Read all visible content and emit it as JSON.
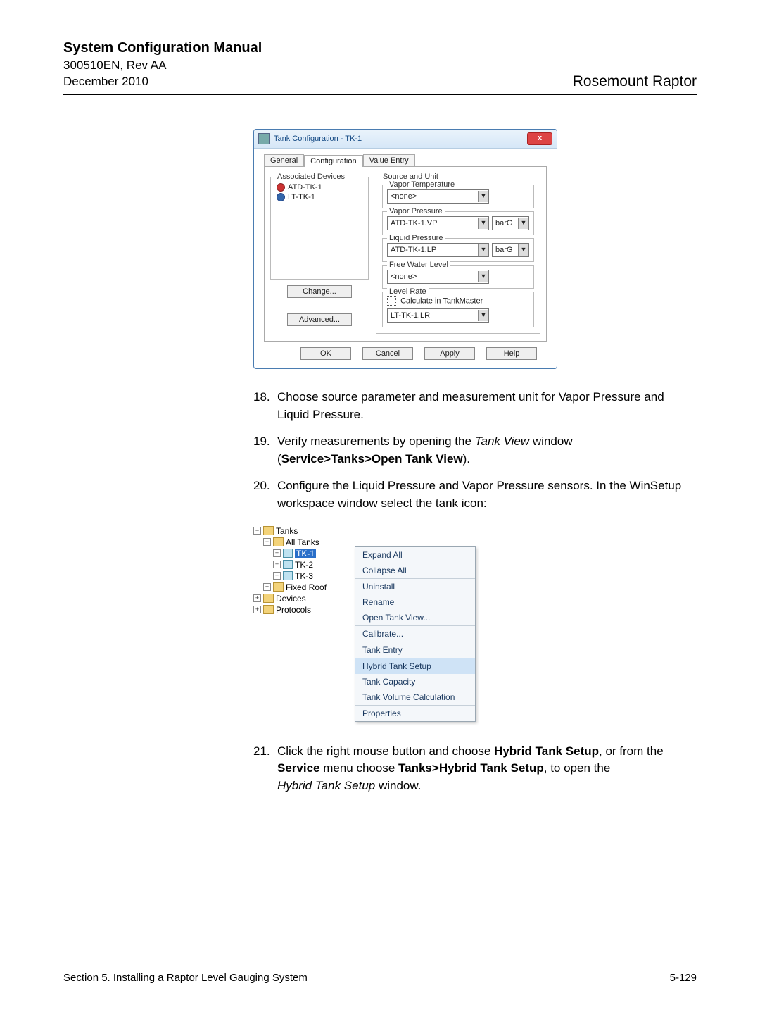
{
  "header": {
    "title": "System Configuration Manual",
    "docnum": "300510EN, Rev AA",
    "date": "December 2010",
    "product": "Rosemount Raptor"
  },
  "dialog1": {
    "title": "Tank Configuration - TK-1",
    "tabs": {
      "general": "General",
      "config": "Configuration",
      "value": "Value Entry"
    },
    "assoc_legend": "Associated Devices",
    "devices": [
      "ATD-TK-1",
      "LT-TK-1"
    ],
    "change": "Change...",
    "advanced": "Advanced...",
    "source_legend": "Source and Unit",
    "vapor_temp": "Vapor Temperature",
    "vapor_press": "Vapor Pressure",
    "liquid_press": "Liquid Pressure",
    "free_water": "Free Water Level",
    "level_rate": "Level Rate",
    "calc_tm": "Calculate in TankMaster",
    "none": "<none>",
    "vp_val": "ATD-TK-1.VP",
    "lp_val": "ATD-TK-1.LP",
    "lr_val": "LT-TK-1.LR",
    "unit": "barG",
    "ok": "OK",
    "cancel": "Cancel",
    "apply": "Apply",
    "help": "Help"
  },
  "instr": {
    "n18": "18.",
    "t18": "Choose source parameter and measurement unit for Vapor Pressure and Liquid Pressure.",
    "n19": "19.",
    "t19a": "Verify measurements by opening the ",
    "t19b": "Tank View",
    "t19c": " window (",
    "t19d": "Service>Tanks>Open Tank View",
    "t19e": ").",
    "n20": "20.",
    "t20": "Configure the Liquid Pressure and Vapor Pressure sensors. In the WinSetup workspace window select the tank icon:",
    "n21": "21.",
    "t21a": "Click the right mouse button and choose ",
    "t21b": "Hybrid Tank Setup",
    "t21c": ", or from the ",
    "t21d": "Service",
    "t21e": " menu choose ",
    "t21f": "Tanks>Hybrid Tank Setup",
    "t21g": ", to open the ",
    "t21h": "Hybrid Tank Setup",
    "t21i": " window."
  },
  "tree": {
    "tanks": "Tanks",
    "all": "All Tanks",
    "tk1": "TK-1",
    "tk2": "TK-2",
    "tk3": "TK-3",
    "fixed": "Fixed Roof",
    "devices": "Devices",
    "protocols": "Protocols"
  },
  "menu": {
    "expand": "Expand All",
    "collapse": "Collapse All",
    "uninstall": "Uninstall",
    "rename": "Rename",
    "open_tv": "Open Tank View...",
    "calibrate": "Calibrate...",
    "tank_entry": "Tank Entry",
    "hybrid": "Hybrid Tank Setup",
    "capacity": "Tank Capacity",
    "volume": "Tank Volume Calculation",
    "properties": "Properties"
  },
  "footer": {
    "section": "Section 5. Installing a Raptor Level Gauging System",
    "page": "5-129"
  }
}
